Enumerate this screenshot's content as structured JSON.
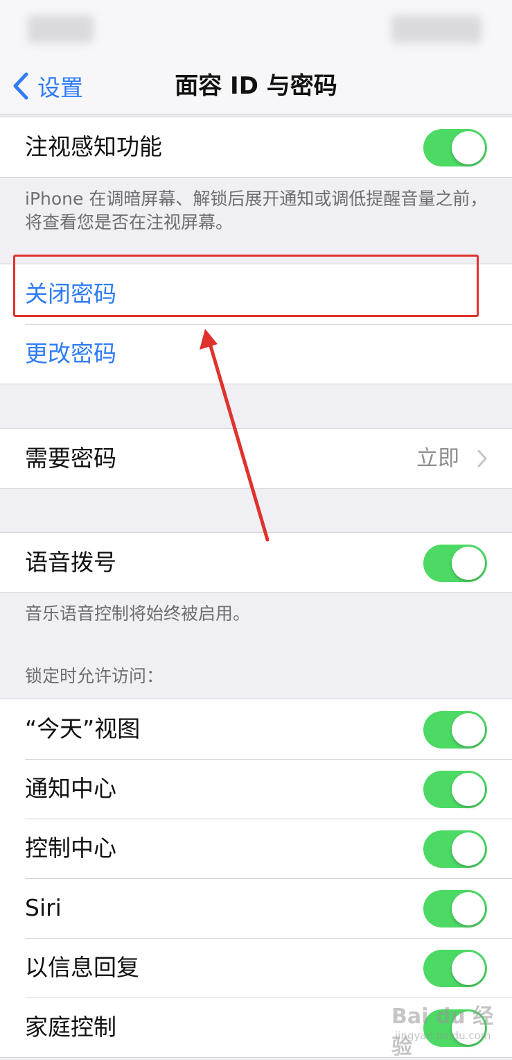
{
  "navbar": {
    "back_label": "设置",
    "title": "面容 ID 与密码"
  },
  "attention": {
    "label": "注视感知功能",
    "toggle_on": true,
    "footer": "iPhone 在调暗屏幕、解锁后展开通知或调低提醒音量之前，将查看您是否在注视屏幕。"
  },
  "passcode": {
    "turn_off": "关闭密码",
    "change": "更改密码"
  },
  "require": {
    "label": "需要密码",
    "value": "立即"
  },
  "voice_dial": {
    "label": "语音拨号",
    "toggle_on": true,
    "footer": "音乐语音控制将始终被启用。"
  },
  "locked_access": {
    "header": "锁定时允许访问：",
    "items": [
      {
        "label": "“今天”视图",
        "on": true
      },
      {
        "label": "通知中心",
        "on": true
      },
      {
        "label": "控制中心",
        "on": true
      },
      {
        "label": "Siri",
        "on": true
      },
      {
        "label": "以信息回复",
        "on": true
      },
      {
        "label": "家庭控制",
        "on": true
      }
    ]
  },
  "watermark": {
    "text": "Bai du 经验",
    "url": "jingyan.baidu.com"
  },
  "colors": {
    "accent": "#2f7cf6",
    "toggle_on": "#4cd964",
    "annotation": "#e0322c"
  }
}
